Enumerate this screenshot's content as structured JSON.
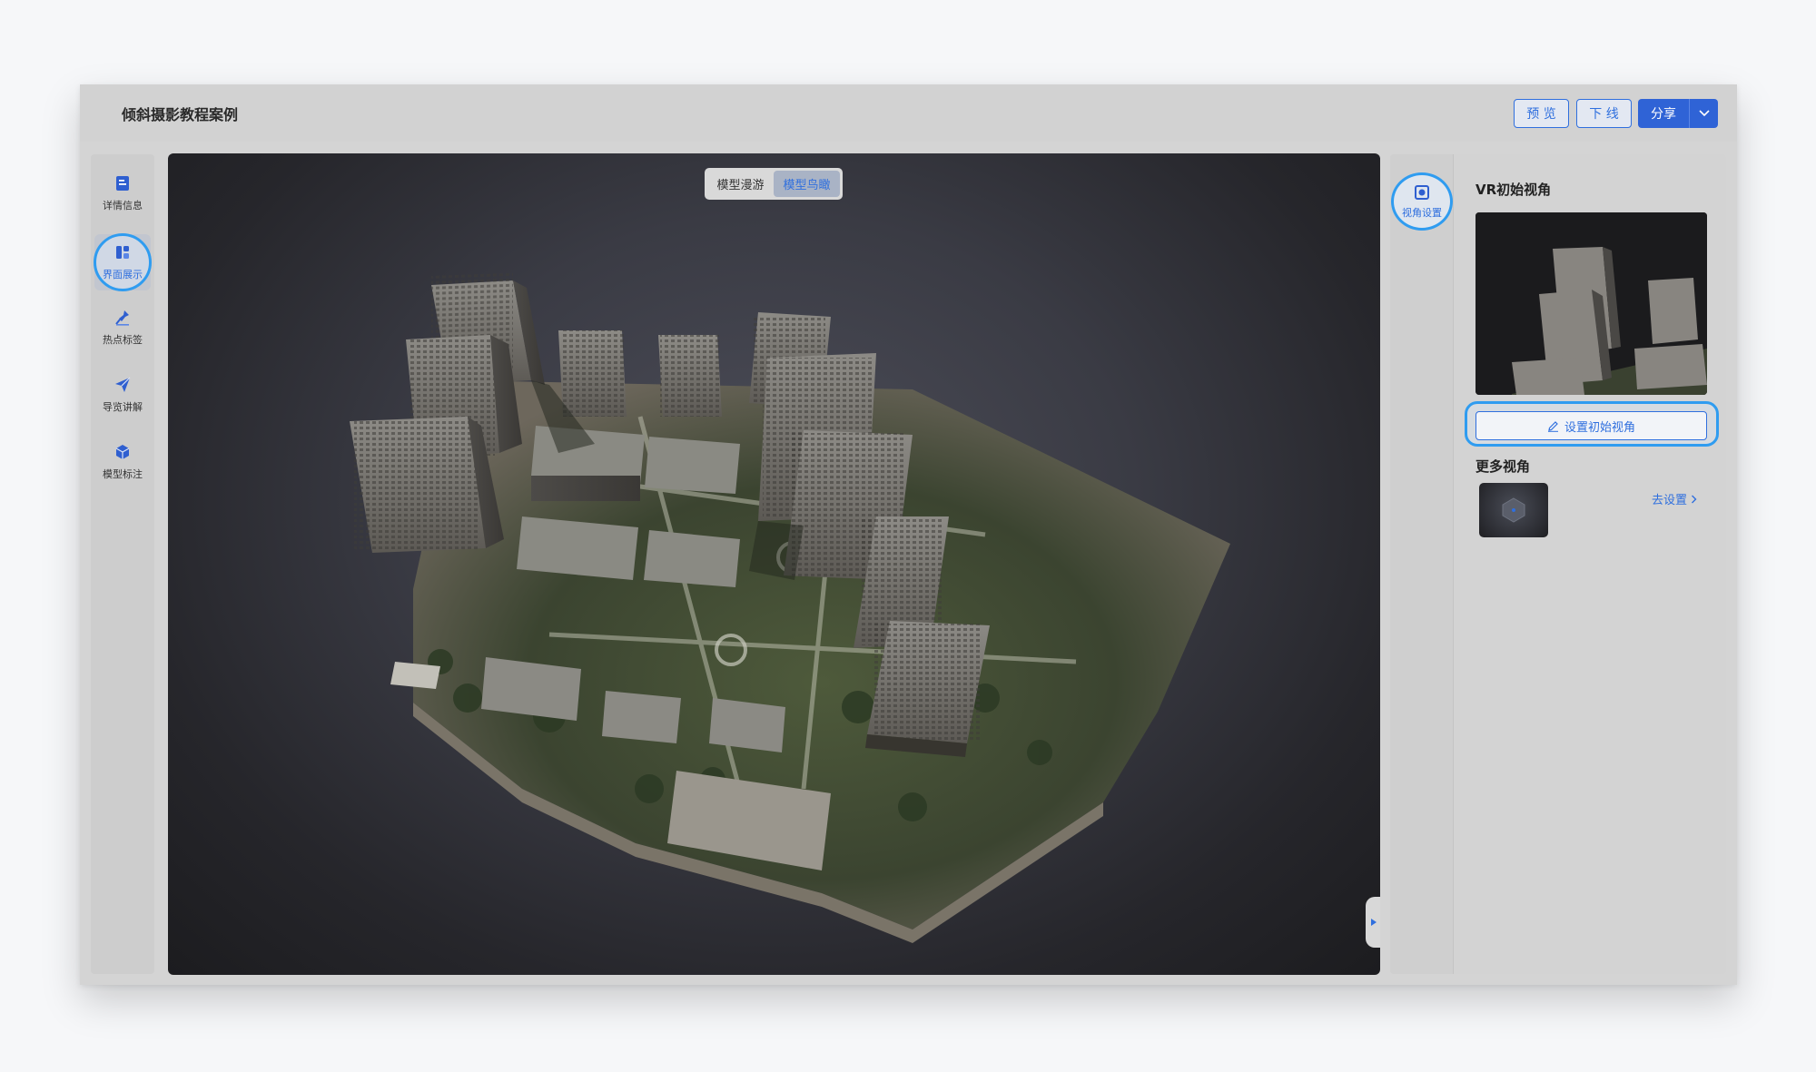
{
  "header": {
    "title": "倾斜摄影教程案例",
    "preview_label": "预 览",
    "offline_label": "下 线",
    "share_label": "分享"
  },
  "left_nav": {
    "items": [
      {
        "label": "详情信息",
        "icon": "document-icon"
      },
      {
        "label": "界面展示",
        "icon": "layout-icon",
        "active": true
      },
      {
        "label": "热点标签",
        "icon": "pin-icon"
      },
      {
        "label": "导览讲解",
        "icon": "paper-plane-icon"
      },
      {
        "label": "模型标注",
        "icon": "cube-icon"
      }
    ]
  },
  "viewport": {
    "modes": [
      "模型漫游",
      "模型鸟瞰"
    ],
    "selected_mode": "模型鸟瞰"
  },
  "right_tabs": {
    "view_settings_label": "视角设置"
  },
  "right_panel": {
    "vr_initial_title": "VR初始视角",
    "set_initial_button": "设置初始视角",
    "more_views_title": "更多视角",
    "goto_settings_link": "去设置"
  },
  "colors": {
    "accent": "#2f6fde",
    "highlight_ring": "#2f9cf0",
    "share_bg": "#2f63d6"
  }
}
